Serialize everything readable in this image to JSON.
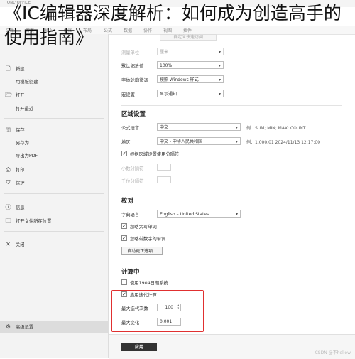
{
  "app_name": "ONLYOFFICE",
  "overlay_title": "《IC编辑器深度解析：如何成为创造高手的使用指南》",
  "menu": [
    "文件",
    "首页",
    "插入",
    "绘图",
    "布局",
    "公式",
    "数据",
    "协作",
    "视图",
    "插件"
  ],
  "sidebar": {
    "items": [
      {
        "label": "新建",
        "icon": "new-file-icon",
        "glyph": "🗋"
      },
      {
        "label": "用模板创建",
        "icon": "",
        "glyph": ""
      },
      {
        "label": "打开",
        "icon": "open-folder-icon",
        "glyph": "🗁"
      },
      {
        "label": "打开最近",
        "icon": "",
        "glyph": ""
      },
      {
        "label": "保存",
        "icon": "save-icon",
        "glyph": "🖫"
      },
      {
        "label": "另存为",
        "icon": "",
        "glyph": ""
      },
      {
        "label": "导出为PDF",
        "icon": "",
        "glyph": ""
      },
      {
        "label": "打印",
        "icon": "print-icon",
        "glyph": "⎙"
      },
      {
        "label": "保护",
        "icon": "shield-icon",
        "glyph": "⛉"
      },
      {
        "label": "信息",
        "icon": "info-icon",
        "glyph": "ⓘ"
      },
      {
        "label": "打开文件所在位置",
        "icon": "folder-location-icon",
        "glyph": "🗀"
      },
      {
        "label": "关闭",
        "icon": "close-icon",
        "glyph": "✕"
      },
      {
        "label": "高级设置",
        "icon": "gear-icon",
        "glyph": "⚙"
      }
    ]
  },
  "general": {
    "custom_quick_access_btn": "自定义快速访问",
    "unit_label": "测量单位",
    "unit_value": "厘米",
    "zoom_label": "默认缩放值",
    "zoom_value": "100%",
    "font_hinting_label": "字体轮廓微调",
    "font_hinting_value": "按照 Windows 样式",
    "macros_label": "宏设置",
    "macros_value": "显示通知"
  },
  "regional": {
    "title": "区域设置",
    "formula_lang_label": "公式语言",
    "formula_lang_value": "中文",
    "formula_example": "例：SUM; MIN; MAX; COUNT",
    "region_label": "地区",
    "region_value": "中文 - 中华人民共和国",
    "region_example": "例：1,000.01 2024/11/13 12:17:00",
    "use_separators_label": "根据区域设置使用分隔符",
    "decimal_sep_label": "小数分隔符",
    "thousands_sep_label": "千位分隔符"
  },
  "proofing": {
    "title": "校对",
    "dict_lang_label": "字典语言",
    "dict_lang_value": "English – United States",
    "ignore_upper_label": "忽略大写单词",
    "ignore_numbers_label": "忽略带数字的单词",
    "autocorrect_btn": "自动更正选项..."
  },
  "calculation": {
    "title": "计算中",
    "date1904_label": "使用1904日期系统",
    "iterative_label": "启用迭代计算",
    "max_iter_label": "最大迭代次数",
    "max_iter_value": "100",
    "max_change_label": "最大变化",
    "max_change_value": "0.001"
  },
  "apply_btn": "应用",
  "watermark": "CSDN @不hellow"
}
